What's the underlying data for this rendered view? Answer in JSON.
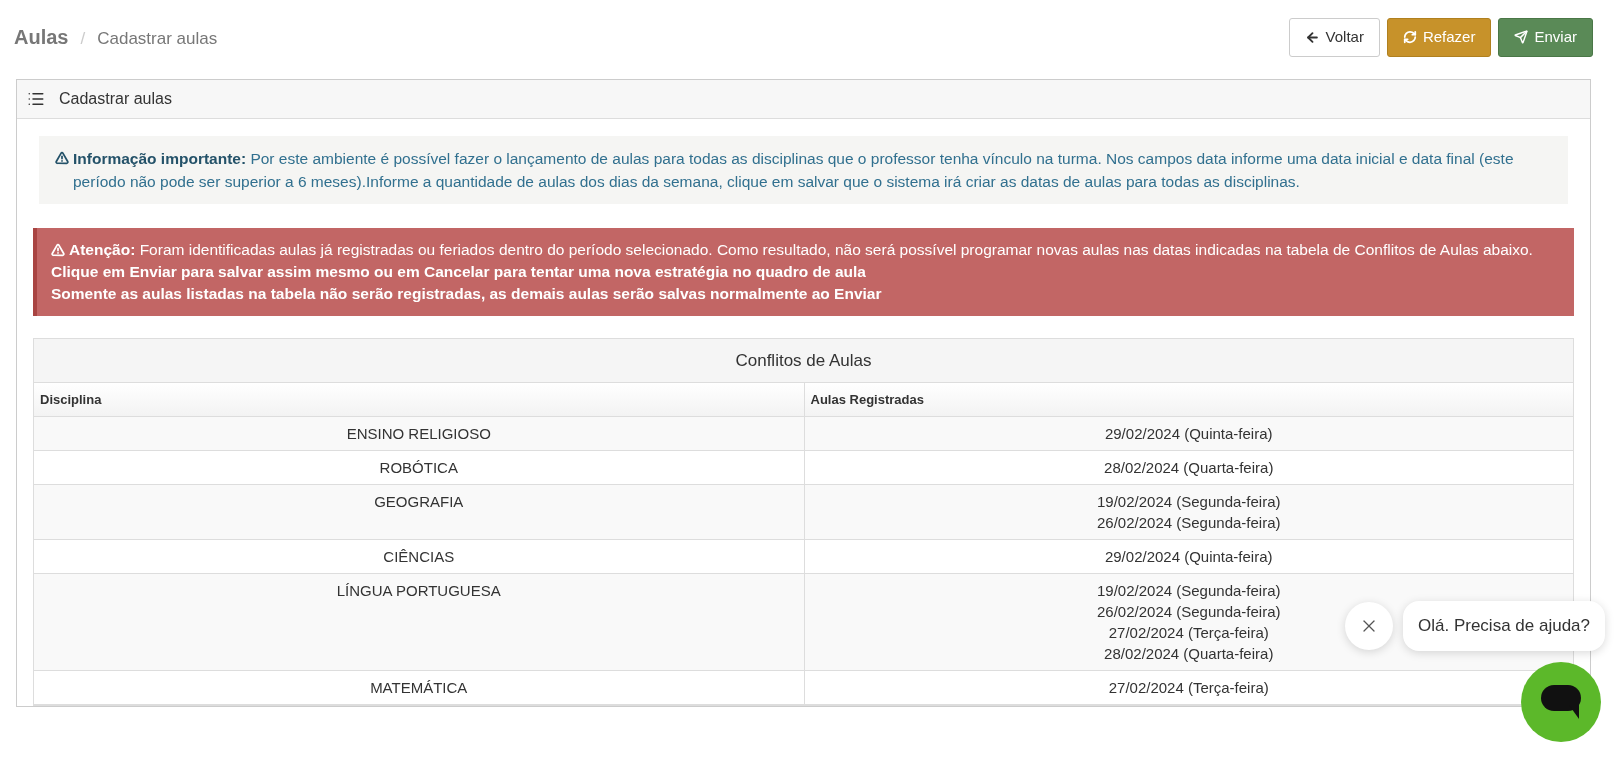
{
  "breadcrumb": {
    "title": "Aulas",
    "separator": "/",
    "current": "Cadastrar aulas"
  },
  "actions": [
    {
      "kind": "back",
      "label": "Voltar"
    },
    {
      "kind": "redo",
      "label": "Refazer"
    },
    {
      "kind": "send",
      "label": "Enviar"
    }
  ],
  "panel": {
    "title": "Cadastrar aulas"
  },
  "info": {
    "text": "**Informação importante:** Por este ambiente é possível fazer o lançamento de aulas para todas as disciplinas que o professor tenha vínculo na turma. Nos campos data informe uma data inicial e data final (este período não pode ser superior a 6 meses).Informe a quantidade de aulas dos dias da semana, clique em salvar que o sistema irá criar as datas de aulas para todas as disciplinas."
  },
  "alert": {
    "lines": [
      "**Atenção:** Foram identificadas aulas já registradas ou feriados dentro do período selecionado. Como resultado, não será possível programar novas aulas nas datas indicadas na tabela de Conflitos de Aulas abaixo.",
      "Clique em Enviar para salvar assim mesmo ou em Cancelar para tentar uma nova estratégia no quadro de aula",
      "Somente as aulas listadas na tabela não serão registradas, as demais aulas serão salvas normalmente ao Enviar"
    ]
  },
  "table": {
    "title": "Conflitos de Aulas",
    "columns": [
      "Disciplina",
      "Aulas Registradas"
    ],
    "rows": [
      {
        "discipline": "ENSINO RELIGIOSO",
        "dates": [
          "29/02/2024 (Quinta-feira)"
        ]
      },
      {
        "discipline": "ROBÓTICA",
        "dates": [
          "28/02/2024 (Quarta-feira)"
        ]
      },
      {
        "discipline": "GEOGRAFIA",
        "dates": [
          "19/02/2024 (Segunda-feira)",
          "26/02/2024 (Segunda-feira)"
        ]
      },
      {
        "discipline": "CIÊNCIAS",
        "dates": [
          "29/02/2024 (Quinta-feira)"
        ]
      },
      {
        "discipline": "LÍNGUA PORTUGUESA",
        "dates": [
          "19/02/2024 (Segunda-feira)",
          "26/02/2024 (Segunda-feira)",
          "27/02/2024 (Terça-feira)",
          "28/02/2024 (Quarta-feira)"
        ]
      },
      {
        "discipline": "MATEMÁTICA",
        "dates": [
          "27/02/2024 (Terça-feira)"
        ]
      }
    ]
  },
  "chat": {
    "message": "Olá. Precisa de ajuda?"
  }
}
